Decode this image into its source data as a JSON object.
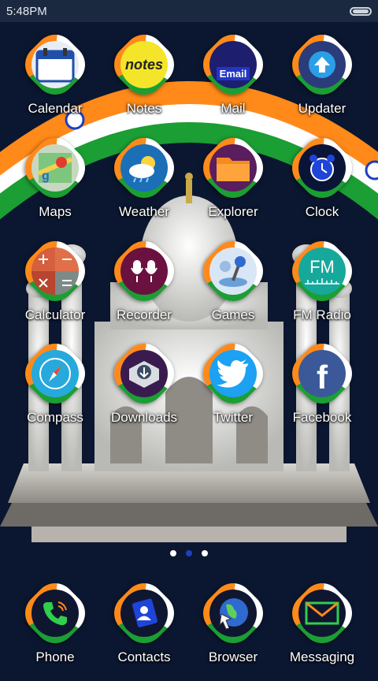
{
  "status_bar": {
    "time": "5:48PM"
  },
  "apps": [
    {
      "label": "Calendar",
      "icon": "calendar-icon"
    },
    {
      "label": "Notes",
      "icon": "notes-icon",
      "tile_text": "notes"
    },
    {
      "label": "Mail",
      "icon": "mail-icon",
      "tile_text": "Email"
    },
    {
      "label": "Updater",
      "icon": "updater-icon"
    },
    {
      "label": "Maps",
      "icon": "maps-icon"
    },
    {
      "label": "Weather",
      "icon": "weather-icon"
    },
    {
      "label": "Explorer",
      "icon": "folder-icon"
    },
    {
      "label": "Clock",
      "icon": "alarm-clock-icon"
    },
    {
      "label": "Calculator",
      "icon": "calculator-icon"
    },
    {
      "label": "Recorder",
      "icon": "microphone-icon"
    },
    {
      "label": "Games",
      "icon": "joystick-icon"
    },
    {
      "label": "FM Radio",
      "icon": "radio-icon",
      "tile_text": "FM"
    },
    {
      "label": "Compass",
      "icon": "compass-icon"
    },
    {
      "label": "Downloads",
      "icon": "download-icon"
    },
    {
      "label": "Twitter",
      "icon": "twitter-bird-icon"
    },
    {
      "label": "Facebook",
      "icon": "facebook-icon",
      "tile_text": "f"
    }
  ],
  "page_indicator": {
    "count": 3,
    "active_index": 1
  },
  "dock": [
    {
      "label": "Phone",
      "icon": "phone-icon"
    },
    {
      "label": "Contacts",
      "icon": "contacts-icon"
    },
    {
      "label": "Browser",
      "icon": "globe-icon"
    },
    {
      "label": "Messaging",
      "icon": "envelope-icon"
    }
  ],
  "colors": {
    "saffron": "#ff8a1a",
    "white": "#ffffff",
    "green": "#1b9e33",
    "background": "#0b1730"
  }
}
